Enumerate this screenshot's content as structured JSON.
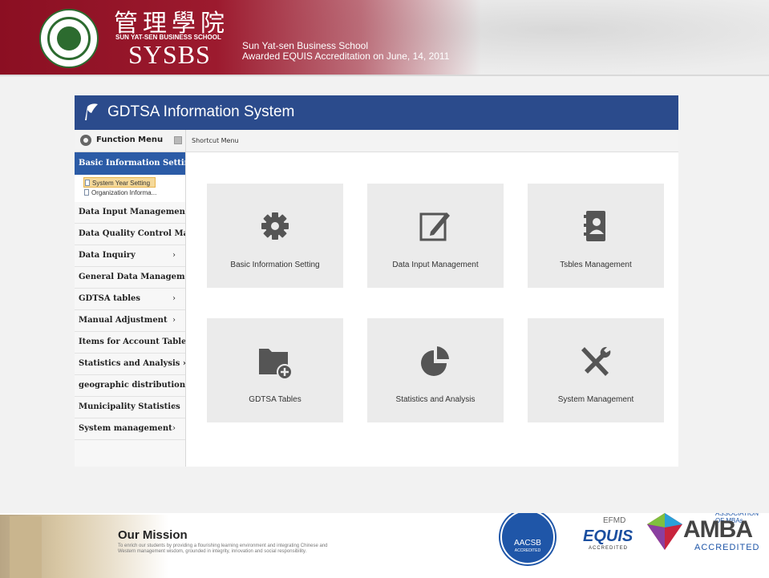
{
  "banner": {
    "school_cn": "管理學院",
    "school_en_small": "SUN YAT-SEN BUSINESS SCHOOL",
    "acronym": "SYSBS",
    "line1": "Sun Yat-sen Business School",
    "line2": "Awarded EQUIS Accreditation on June, 14, 2011"
  },
  "app": {
    "title": "GDTSA Information System"
  },
  "sidebar": {
    "header": "Function Menu",
    "active": "Basic Information Setting",
    "subitems": [
      {
        "label": "System Year Setting"
      },
      {
        "label": "Organization Informa..."
      }
    ],
    "items": [
      {
        "label": "Data Input Management",
        "arrow": ""
      },
      {
        "label": "Data Quality Control Ma...",
        "arrow": ""
      },
      {
        "label": "Data Inquiry",
        "arrow": "›"
      },
      {
        "label": "General Data Management",
        "arrow": ""
      },
      {
        "label": "GDTSA tables",
        "arrow": "›"
      },
      {
        "label": "Manual Adjustment",
        "arrow": "›"
      },
      {
        "label": "Items for Account Table...",
        "arrow": ""
      },
      {
        "label": "Statistics and Analysis ›",
        "arrow": ""
      },
      {
        "label": "geographic distribution›...",
        "arrow": ""
      },
      {
        "label": "Municipality Statistics",
        "arrow": "›"
      },
      {
        "label": "System management",
        "arrow": "›"
      }
    ]
  },
  "main": {
    "breadcrumb": "Shortcut Menu",
    "tiles": [
      {
        "label": "Basic Information Setting",
        "icon": "gear-icon"
      },
      {
        "label": "Data Input Management",
        "icon": "edit-icon"
      },
      {
        "label": "Tsbles Management",
        "icon": "contacts-book-icon"
      },
      {
        "label": "GDTSA Tables",
        "icon": "folder-add-icon"
      },
      {
        "label": "Statistics and Analysis",
        "icon": "pie-chart-icon"
      },
      {
        "label": "System Management",
        "icon": "tools-icon"
      }
    ]
  },
  "footer": {
    "mission_title": "Our Mission",
    "mission_text": "To enrich our students by providing a flourishing learning environment and integrating Chinese and Western management wisdom, grounded in integrity, innovation and social responsibility.",
    "aacsb": "AACSB",
    "aacsb_sub": "ACCREDITED",
    "efmd": "EFMD",
    "equis": "EQUIS",
    "equis_sub": "ACCREDITED",
    "amba_assoc": "ASSOCIATION OF MBAs",
    "amba": "AMBA",
    "amba_sub": "ACCREDITED"
  },
  "colors": {
    "banner_red": "#9c1a2e",
    "app_header_blue": "#2b4b8c",
    "sidebar_active": "#2b5ba6",
    "tile_bg": "#ebebeb",
    "icon_gray": "#555555"
  }
}
